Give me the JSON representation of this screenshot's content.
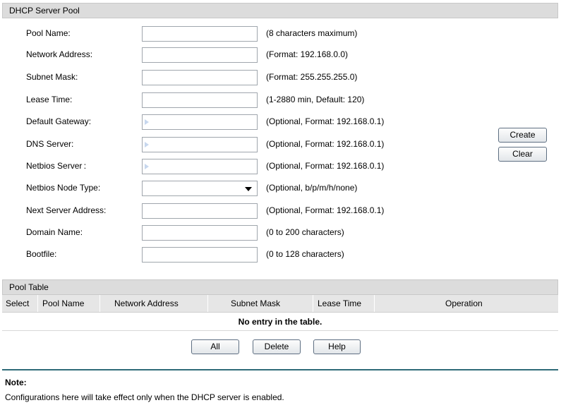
{
  "pool_section": {
    "title": "DHCP Server Pool",
    "fields": [
      {
        "label": "Pool Name:",
        "value": "",
        "hint": "(8 characters maximum)"
      },
      {
        "label": "Network Address:",
        "value": "",
        "hint": "(Format: 192.168.0.0)"
      },
      {
        "label": "Subnet Mask:",
        "value": "",
        "hint": "(Format: 255.255.255.0)"
      },
      {
        "label": "Lease Time:",
        "value": "",
        "hint": "(1-2880 min, Default: 120)"
      },
      {
        "label": "Default Gateway:",
        "value": "",
        "hint": "(Optional, Format: 192.168.0.1)"
      },
      {
        "label": "DNS Server:",
        "value": "",
        "hint": "(Optional, Format: 192.168.0.1)"
      },
      {
        "label": "Netbios Server :",
        "value": "",
        "hint": "(Optional, Format: 192.168.0.1)"
      },
      {
        "label": "Netbios Node Type:",
        "value": "",
        "hint": "(Optional, b/p/m/h/none)"
      },
      {
        "label": "Next Server Address:",
        "value": "",
        "hint": "(Optional, Format: 192.168.0.1)"
      },
      {
        "label": "Domain Name:",
        "value": "",
        "hint": "(0 to 200 characters)"
      },
      {
        "label": "Bootfile:",
        "value": "",
        "hint": "(0 to 128 characters)"
      }
    ],
    "create_label": "Create",
    "clear_label": "Clear"
  },
  "table_section": {
    "title": "Pool Table",
    "columns": [
      "Select",
      "Pool Name",
      "Network Address",
      "Subnet Mask",
      "Lease Time",
      "Operation"
    ],
    "empty_message": "No entry in the table.",
    "all_label": "All",
    "delete_label": "Delete",
    "help_label": "Help"
  },
  "note": {
    "title": "Note:",
    "text": "Configurations here will take effect only when the DHCP server is enabled."
  },
  "icons": {
    "input_marker": "triangle-right-icon",
    "select_caret": "caret-down-icon"
  },
  "colors": {
    "header_bg": "#dcdcdc",
    "divider": "#2f6b78",
    "input_marker": "#c7d7ee"
  }
}
